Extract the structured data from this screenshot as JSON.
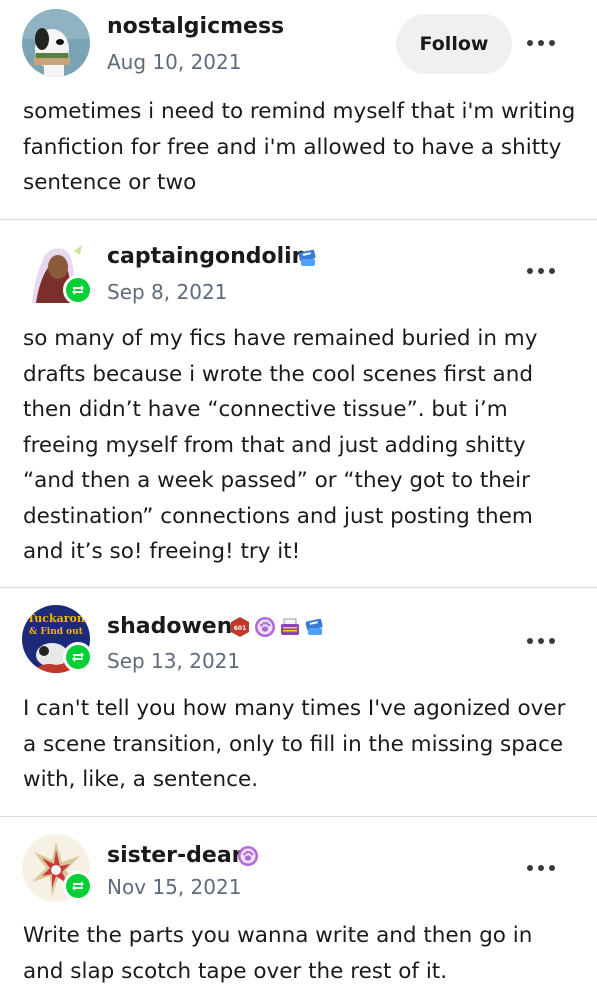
{
  "posts": [
    {
      "username": "nostalgicmess",
      "date": "Aug 10, 2021",
      "follow_label": "Follow",
      "text": "sometimes i need to remind myself that i'm writing fanfiction for free and i'm allowed to have a shitty sentence or two"
    },
    {
      "username": "captaingondolin",
      "date": "Sep 8, 2021",
      "text": "so many of my fics have remained buried in my drafts because i wrote the cool scenes first and then didn’t have “connective tissue”. but i’m freeing myself from that and just adding shitty “and then a week passed” or “they got to their destination” connections and just posting them and it’s so! freeing! try it!"
    },
    {
      "username": "shadowen",
      "date": "Sep 13, 2021",
      "avatar_text": [
        "Tuckaron",
        "& Find out"
      ],
      "badge_number": "601",
      "text": "I can't tell you how many times I've agonized over a scene transition, only to fill in the missing space with, like, a sentence."
    },
    {
      "username": "sister-dear",
      "date": "Nov 15, 2021",
      "text": "Write the parts you wanna write and then go in and slap scotch tape over the rest of it."
    }
  ],
  "colors": {
    "reblog_green": "#00cf35",
    "date_gray": "#5f6b7a",
    "divider": "#dcdcdc"
  },
  "icons": [
    "reblog-icon",
    "more-options-icon",
    "paw-badge-icon",
    "typewriter-badge-icon",
    "blue-badge-icon"
  ]
}
